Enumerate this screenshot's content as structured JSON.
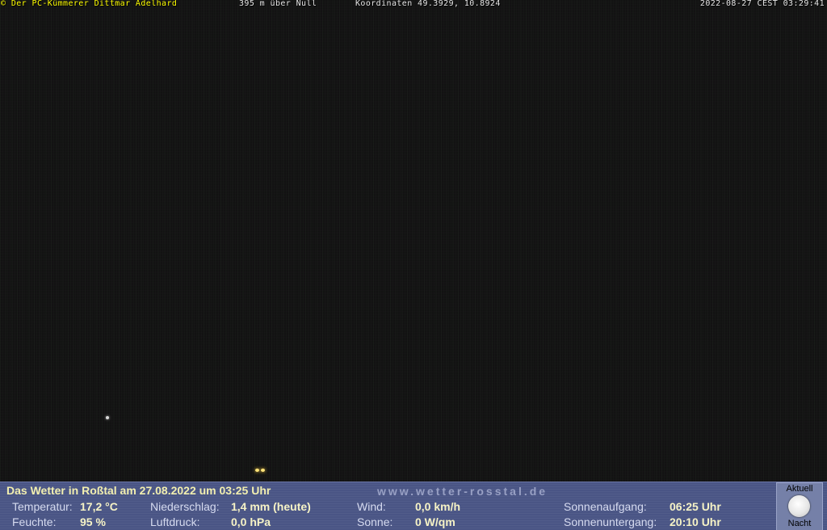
{
  "overlay": {
    "copyright": "© Der PC-Kümmerer Dittmar Adelhard",
    "altitude": "395 m über Null",
    "coordinates": "Koordinaten 49.3929, 10.8924",
    "datetime": "2022-08-27 CEST 03:29:41"
  },
  "panel": {
    "title": "Das Wetter in Roßtal am 27.08.2022 um 03:25 Uhr",
    "url": "www.wetter-rosstal.de",
    "temperature": {
      "label": "Temperatur:",
      "value": "17,2 °C"
    },
    "humidity": {
      "label": "Feuchte:",
      "value": "95 %"
    },
    "precipitation": {
      "label": "Niederschlag:",
      "value": "1,4 mm (heute)"
    },
    "pressure": {
      "label": "Luftdruck:",
      "value": "0,0 hPa"
    },
    "wind": {
      "label": "Wind:",
      "value": "0,0 km/h"
    },
    "sun": {
      "label": "Sonne:",
      "value": "0 W/qm"
    },
    "sunrise": {
      "label": "Sonnenaufgang:",
      "value": "06:25 Uhr"
    },
    "sunset": {
      "label": "Sonnenuntergang:",
      "value": "20:10 Uhr"
    },
    "moon": {
      "top_label": "Aktuell",
      "bottom_label": "Nacht",
      "icon": "moon-icon"
    }
  },
  "colors": {
    "panel_background": "#4a5585",
    "title_text": "#f2efb0",
    "copyright_text": "#ffff00"
  }
}
